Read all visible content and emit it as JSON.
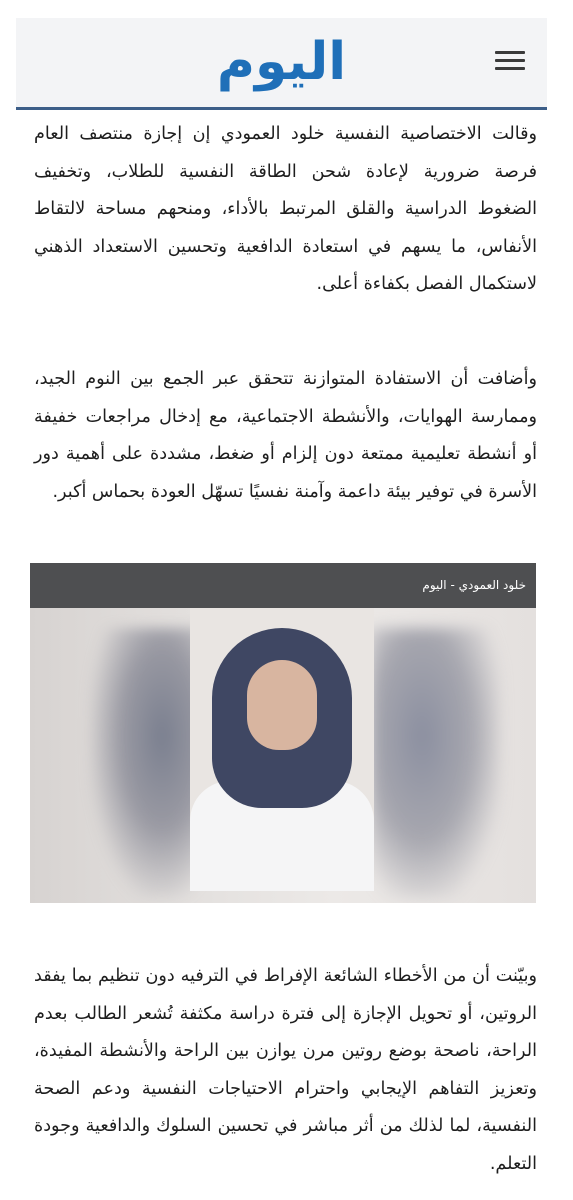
{
  "header": {
    "logo_text": "اليوم",
    "menu_icon": "hamburger-menu-icon"
  },
  "article": {
    "paragraph_1": "وقالت الاختصاصية النفسية خلود العمودي إن إجازة منتصف العام فرصة ضرورية لإعادة شحن الطاقة النفسية للطلاب، وتخفيف الضغوط الدراسية والقلق المرتبط بالأداء، ومنحهم مساحة لالتقاط الأنفاس، ما يسهم في استعادة الدافعية وتحسين الاستعداد الذهني لاستكمال الفصل بكفاءة أعلى.",
    "paragraph_2": "وأضافت أن الاستفادة المتوازنة تتحقق عبر الجمع بين النوم الجيد، وممارسة الهوايات، والأنشطة الاجتماعية، مع إدخال مراجعات خفيفة أو أنشطة تعليمية ممتعة دون إلزام أو ضغط، مشددة على أهمية دور الأسرة في توفير بيئة داعمة وآمنة نفسيًا تسهّل العودة بحماس أكبر.",
    "photo_caption": "خلود العمودي - اليوم",
    "paragraph_3": "وبيّنت أن من الأخطاء الشائعة الإفراط في الترفيه دون تنظيم بما يفقد الروتين، أو تحويل الإجازة إلى فترة دراسة مكثفة تُشعر الطالب بعدم الراحة، ناصحة بوضع روتين مرن يوازن بين الراحة والأنشطة المفيدة، وتعزيز التفاهم الإيجابي واحترام الاحتياجات النفسية ودعم الصحة النفسية، لما لذلك من أثر مباشر في تحسين السلوك والدافعية وجودة التعلم."
  },
  "colors": {
    "logo_blue": "#1f6fb8",
    "header_border": "#3c5e88",
    "caption_bar": "#4e4f51"
  }
}
